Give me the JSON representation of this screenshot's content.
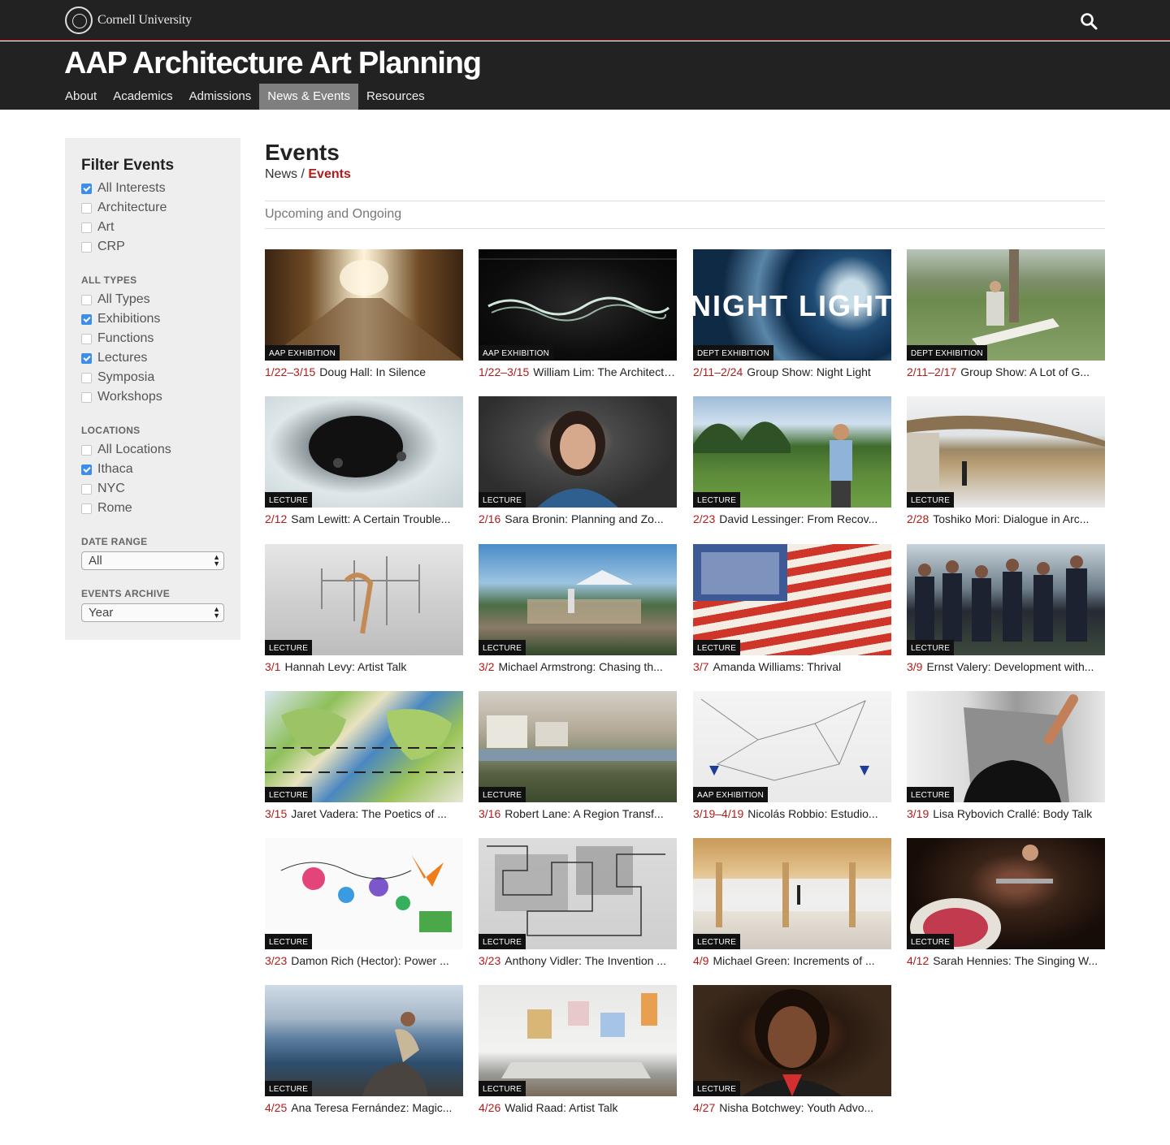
{
  "header": {
    "university": "Cornell University",
    "site_title": "AAP Architecture Art Planning",
    "nav": [
      {
        "label": "About",
        "active": false
      },
      {
        "label": "Academics",
        "active": false
      },
      {
        "label": "Admissions",
        "active": false
      },
      {
        "label": "News & Events",
        "active": true
      },
      {
        "label": "Resources",
        "active": false
      }
    ],
    "search_icon": "search-icon"
  },
  "filter": {
    "title": "Filter Events",
    "interests": [
      {
        "label": "All Interests",
        "checked": true
      },
      {
        "label": "Architecture",
        "checked": false
      },
      {
        "label": "Art",
        "checked": false
      },
      {
        "label": "CRP",
        "checked": false
      }
    ],
    "types_title": "ALL TYPES",
    "types": [
      {
        "label": "All Types",
        "checked": false
      },
      {
        "label": "Exhibitions",
        "checked": true
      },
      {
        "label": "Functions",
        "checked": false
      },
      {
        "label": "Lectures",
        "checked": true
      },
      {
        "label": "Symposia",
        "checked": false
      },
      {
        "label": "Workshops",
        "checked": false
      }
    ],
    "locations_title": "LOCATIONS",
    "locations": [
      {
        "label": "All Locations",
        "checked": false
      },
      {
        "label": "Ithaca",
        "checked": true
      },
      {
        "label": "NYC",
        "checked": false
      },
      {
        "label": "Rome",
        "checked": false
      }
    ],
    "date_range_title": "DATE RANGE",
    "date_range_value": "All",
    "archive_title": "EVENTS ARCHIVE",
    "archive_value": "Year"
  },
  "main": {
    "title": "Events",
    "breadcrumb_parent": "News",
    "breadcrumb_sep": "/",
    "breadcrumb_current": "Events",
    "section_title": "Upcoming and Ongoing"
  },
  "colors": {
    "accent": "#b31b1b",
    "header_bg": "#222222",
    "checkbox": "#3d8ee8"
  },
  "events": [
    {
      "tag": "AAP EXHIBITION",
      "date": "1/22–3/15",
      "title": "Doug Hall: In Silence"
    },
    {
      "tag": "AAP EXHIBITION",
      "date": "1/22–3/15",
      "title": "William Lim: The Architecture of Hong Kong"
    },
    {
      "tag": "DEPT EXHIBITION",
      "date": "2/11–2/24",
      "title": "Group Show: Night Light",
      "image_text": "NIGHT LIGHT"
    },
    {
      "tag": "DEPT EXHIBITION",
      "date": "2/11–2/17",
      "title": "Group Show: A Lot of G..."
    },
    {
      "tag": "LECTURE",
      "date": "2/12",
      "title": "Sam Lewitt: A Certain Trouble..."
    },
    {
      "tag": "LECTURE",
      "date": "2/16",
      "title": "Sara Bronin: Planning and Zo..."
    },
    {
      "tag": "LECTURE",
      "date": "2/23",
      "title": "David Lessinger: From Recov..."
    },
    {
      "tag": "LECTURE",
      "date": "2/28",
      "title": "Toshiko Mori: Dialogue in Arc..."
    },
    {
      "tag": "LECTURE",
      "date": "3/1",
      "title": "Hannah Levy: Artist Talk"
    },
    {
      "tag": "LECTURE",
      "date": "3/2",
      "title": "Michael Armstrong: Chasing th..."
    },
    {
      "tag": "LECTURE",
      "date": "3/7",
      "title": "Amanda Williams: Thrival"
    },
    {
      "tag": "LECTURE",
      "date": "3/9",
      "title": "Ernst Valery: Development with..."
    },
    {
      "tag": "LECTURE",
      "date": "3/15",
      "title": "Jaret Vadera: The Poetics of ..."
    },
    {
      "tag": "LECTURE",
      "date": "3/16",
      "title": "Robert Lane: A Region Transf..."
    },
    {
      "tag": "AAP EXHIBITION",
      "date": "3/19–4/19",
      "title": "Nicolás Robbio: Estudio..."
    },
    {
      "tag": "LECTURE",
      "date": "3/19",
      "title": "Lisa Rybovich Crallé: Body Talk"
    },
    {
      "tag": "LECTURE",
      "date": "3/23",
      "title": "Damon Rich (Hector): Power ..."
    },
    {
      "tag": "LECTURE",
      "date": "3/23",
      "title": "Anthony Vidler: The Invention ..."
    },
    {
      "tag": "LECTURE",
      "date": "4/9",
      "title": "Michael Green: Increments of ..."
    },
    {
      "tag": "LECTURE",
      "date": "4/12",
      "title": "Sarah Hennies: The Singing W..."
    },
    {
      "tag": "LECTURE",
      "date": "4/25",
      "title": "Ana Teresa Fernández: Magic..."
    },
    {
      "tag": "LECTURE",
      "date": "4/26",
      "title": "Walid Raad: Artist Talk"
    },
    {
      "tag": "LECTURE",
      "date": "4/27",
      "title": "Nisha Botchwey: Youth Advo..."
    }
  ]
}
